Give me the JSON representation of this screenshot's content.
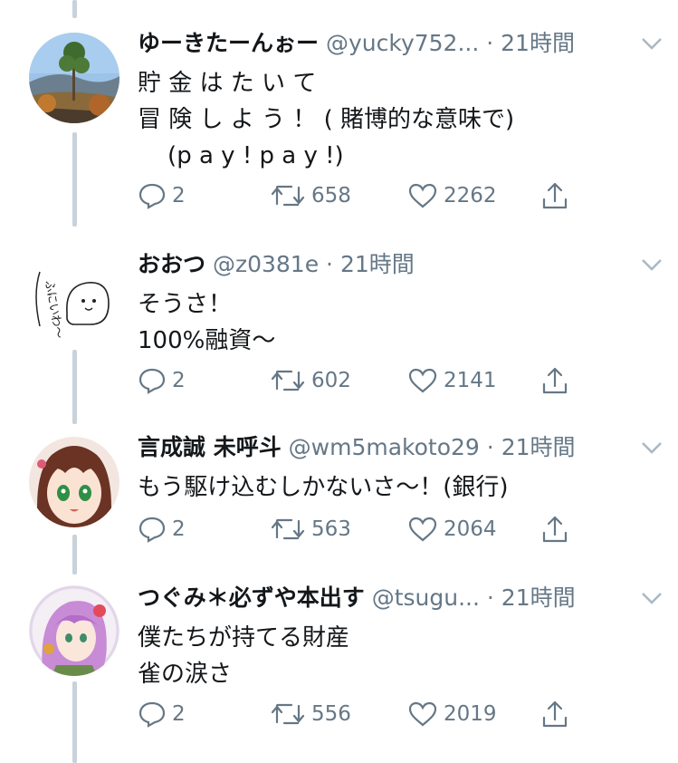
{
  "tweets": [
    {
      "name": "ゆーきたーんぉー",
      "handle": "@yucky752...",
      "sep": " · ",
      "time": "21時間",
      "lines": [
        "貯 金 は た い て",
        "冒 険 し よ う ！ ( 賭博的な意味で)",
        "    (p a y ! p a y !)"
      ],
      "replies": "2",
      "retweets": "658",
      "likes": "2262"
    },
    {
      "name": "おおつ",
      "handle": "@z0381e",
      "sep": " · ",
      "time": "21時間",
      "lines": [
        "そうさ！",
        "100%融資〜"
      ],
      "avatar_text": "ふにいわ〜",
      "replies": "2",
      "retweets": "602",
      "likes": "2141"
    },
    {
      "name": "言成誠 未呼斗",
      "handle": "@wm5makoto29",
      "sep": " · ",
      "time": "21時間",
      "lines": [
        "もう駆け込むしかないさ〜！(銀行)"
      ],
      "replies": "2",
      "retweets": "563",
      "likes": "2064"
    },
    {
      "name": "つぐみ＊必ずや本出す",
      "handle": "@tsugu...",
      "sep": " · ",
      "time": "21時間",
      "lines": [
        "僕たちが持てる財産",
        "雀の涙さ"
      ],
      "replies": "2",
      "retweets": "556",
      "likes": "2019"
    }
  ],
  "icons": {
    "reply": "reply-icon",
    "retweet": "retweet-icon",
    "like": "heart-icon",
    "share": "share-icon",
    "menu": "chevron-down-icon"
  },
  "colors": {
    "text": "#14171a",
    "secondary": "#657786",
    "thread": "#c8d2db"
  }
}
